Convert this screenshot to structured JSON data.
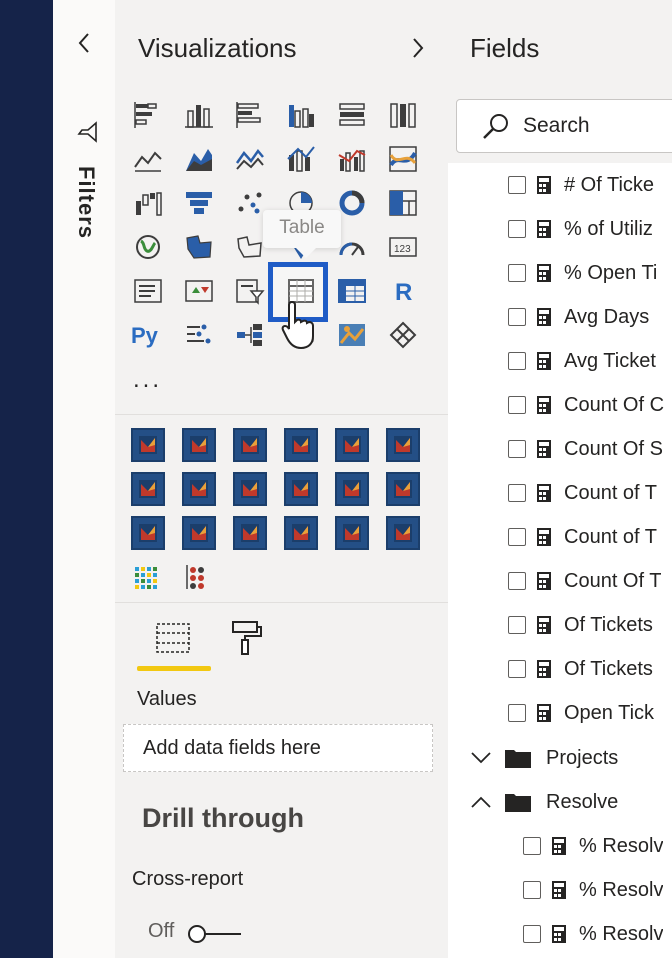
{
  "filters": {
    "label": "Filters"
  },
  "visualizations": {
    "title": "Visualizations",
    "tooltip": "Table",
    "more": "...",
    "build_tabs": [
      {
        "icon": "fields-well-icon"
      },
      {
        "icon": "format-paint-roller-icon"
      }
    ],
    "values_label": "Values",
    "add_fields_placeholder": "Add data fields here",
    "drill_through": {
      "title": "Drill through",
      "cross_report_label": "Cross-report",
      "toggle_state": "Off"
    }
  },
  "fields": {
    "title": "Fields",
    "search_placeholder": "Search",
    "items": [
      {
        "label": "# Of Ticke",
        "type": "measure"
      },
      {
        "label": "% of Utiliz",
        "type": "measure"
      },
      {
        "label": "% Open Ti",
        "type": "measure"
      },
      {
        "label": "Avg Days",
        "type": "measure"
      },
      {
        "label": "Avg Ticket",
        "type": "measure"
      },
      {
        "label": "Count Of C",
        "type": "measure"
      },
      {
        "label": "Count Of S",
        "type": "measure"
      },
      {
        "label": "Count of T",
        "type": "measure"
      },
      {
        "label": "Count of T",
        "type": "measure"
      },
      {
        "label": "Count Of T",
        "type": "measure"
      },
      {
        "label": "Of Tickets",
        "type": "measure"
      },
      {
        "label": "Of Tickets",
        "type": "measure"
      },
      {
        "label": "Open Tick",
        "type": "measure"
      }
    ],
    "folders": [
      {
        "label": "Projects",
        "expanded": false
      },
      {
        "label": "Resolve",
        "expanded": true
      }
    ],
    "resolve_items": [
      {
        "label": "% Resolv"
      },
      {
        "label": "% Resolv"
      },
      {
        "label": "% Resolv"
      }
    ]
  },
  "colors": {
    "nav": "#152349",
    "pane": "#f3f2f1",
    "accent_underline": "#f2c811",
    "highlight_border": "#1f5cc6",
    "custom_visual_bg": "#244f86"
  }
}
